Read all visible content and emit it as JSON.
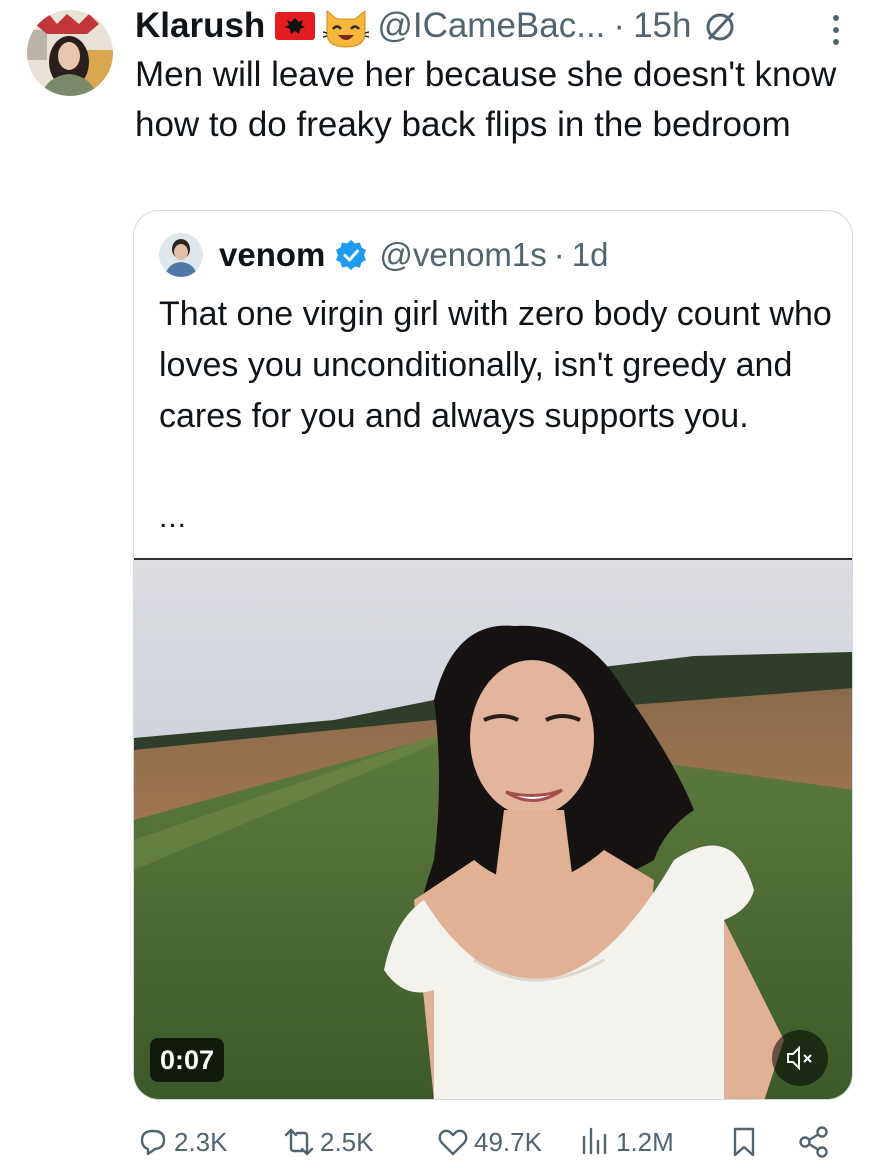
{
  "tweet": {
    "author_name": "Klarush",
    "author_handle": "@ICameBac...",
    "separator": "·",
    "time": "15h",
    "text": "Men will leave her because she doesn't know how to do freaky back flips in the bedroom"
  },
  "quoted_tweet": {
    "author_name": "venom",
    "author_handle": "@venom1s",
    "separator": "·",
    "time": "1d",
    "text": "That one virgin girl with zero body count who loves you unconditionally, isn't greedy and cares for you and always supports you.",
    "ellipsis": "...",
    "video": {
      "duration": "0:07",
      "muted": true
    }
  },
  "actions": {
    "replies": "2.3K",
    "reposts": "2.5K",
    "likes": "49.7K",
    "views": "1.2M"
  },
  "icons": {
    "flag": "albania-flag-icon",
    "emoji": "cat-face-icon",
    "status": "prohibited-icon",
    "more": "more-vertical-icon",
    "verified": "verified-badge-icon",
    "reply": "reply-icon",
    "repost": "repost-icon",
    "like": "heart-icon",
    "views": "views-icon",
    "bookmark": "bookmark-icon",
    "share": "share-icon",
    "mute": "speaker-muted-icon"
  },
  "colors": {
    "text": "#0f1419",
    "secondary": "#536471",
    "verified": "#1d9bf0",
    "border": "#cfd9de"
  }
}
